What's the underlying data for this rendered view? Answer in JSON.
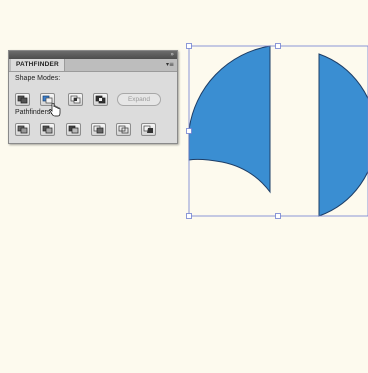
{
  "panel": {
    "tab_label": "PATHFINDER",
    "menu_icon": "panel-menu-icon",
    "collapse_icon": "double-chevron-icon",
    "shape_modes_label": "Shape Modes:",
    "pathfinders_label": "Pathfinders:",
    "expand_label": "Expand",
    "shape_mode_buttons": [
      "unite-icon",
      "minus-front-icon",
      "intersect-icon",
      "exclude-icon"
    ],
    "pathfinder_buttons": [
      "divide-icon",
      "trim-icon",
      "merge-icon",
      "crop-icon",
      "outline-icon",
      "minus-back-icon"
    ]
  },
  "colors": {
    "background": "#fdfaee",
    "shape_fill": "#3a8ed2",
    "shape_stroke": "#1d3d66",
    "selection": "#6f7fd0"
  }
}
